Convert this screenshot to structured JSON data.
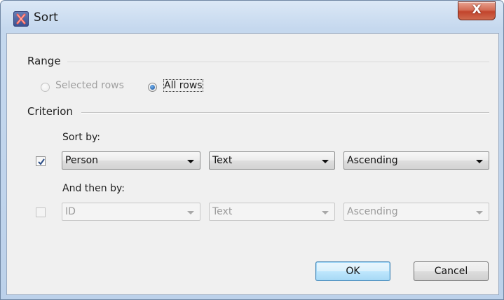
{
  "window": {
    "title": "Sort",
    "close_glyph": "X"
  },
  "range": {
    "label": "Range",
    "selected_rows": {
      "label": "Selected rows",
      "selected": false,
      "enabled": false
    },
    "all_rows": {
      "label": "All rows",
      "selected": true,
      "enabled": true
    }
  },
  "criterion": {
    "label": "Criterion",
    "sort_by": {
      "label": "Sort by:",
      "checked": true,
      "field": "Person",
      "type": "Text",
      "order": "Ascending"
    },
    "then_by": {
      "label": "And then by:",
      "checked": false,
      "field": "ID",
      "type": "Text",
      "order": "Ascending"
    }
  },
  "buttons": {
    "ok": "OK",
    "cancel": "Cancel"
  },
  "icons": {
    "app": "app-x-icon",
    "close": "close-icon",
    "dropdown": "chevron-down-icon",
    "check": "checkmark-icon"
  },
  "colors": {
    "accent": "#3c7fb1",
    "close": "#c2452d",
    "titlebar": "#c5d8ee"
  }
}
